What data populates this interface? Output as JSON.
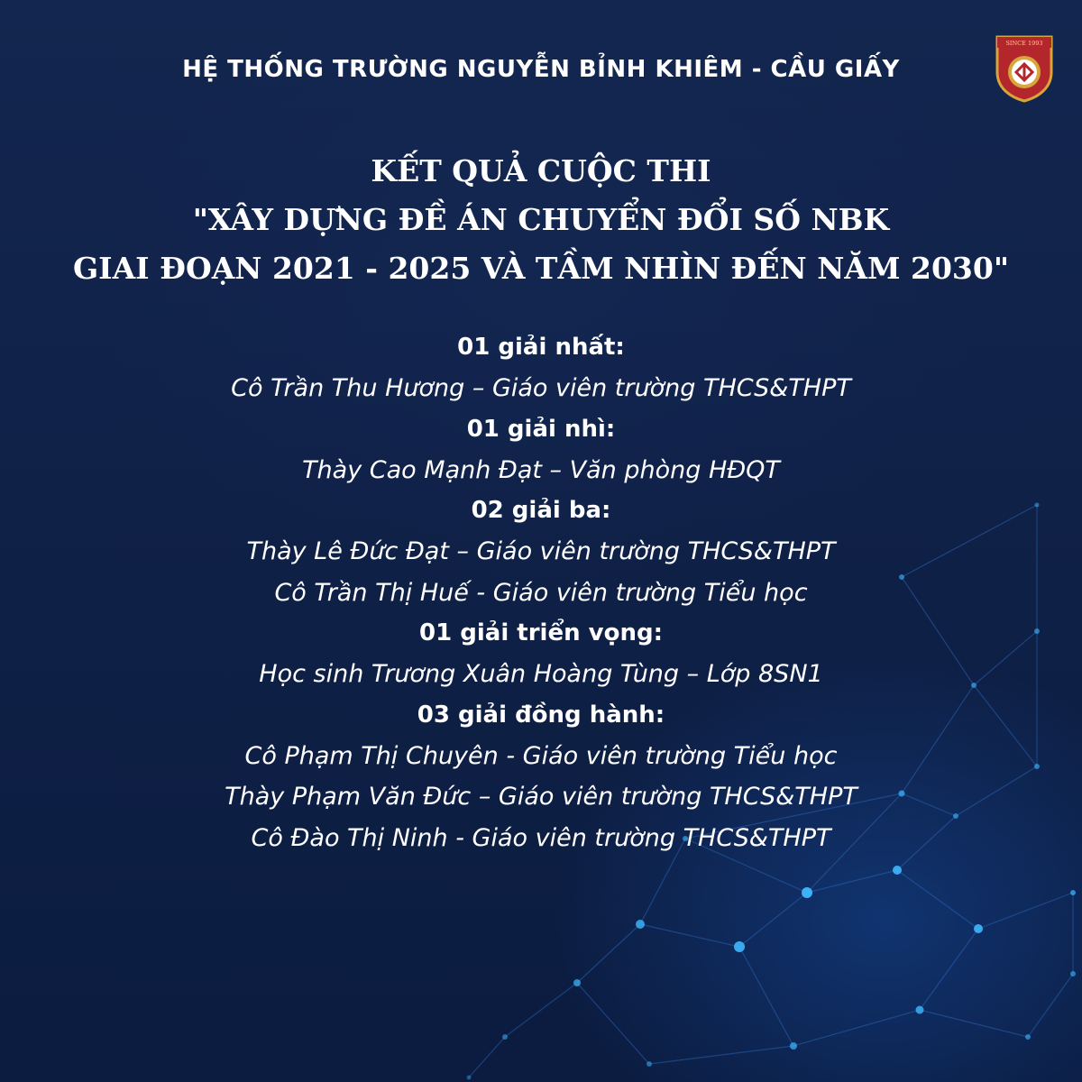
{
  "header": {
    "school_name": "HỆ THỐNG TRƯỜNG NGUYỄN BỈNH KHIÊM - CẦU GIẤY",
    "logo_text": "SINCE 1993"
  },
  "title": {
    "lines": [
      "KẾT QUẢ CUỘC THI",
      "\"XÂY DỰNG ĐỀ ÁN CHUYỂN ĐỔI SỐ NBK",
      "GIAI ĐOẠN 2021 - 2025 VÀ TẦM NHÌN ĐẾN NĂM 2030\""
    ]
  },
  "awards": [
    {
      "label": "01 giải nhất:",
      "winners": [
        "Cô Trần Thu Hương – Giáo viên trường THCS&THPT"
      ]
    },
    {
      "label": "01 giải nhì:",
      "winners": [
        "Thày Cao Mạnh Đạt – Văn phòng HĐQT"
      ]
    },
    {
      "label": "02 giải ba:",
      "winners": [
        "Thày Lê Đức Đạt – Giáo viên trường THCS&THPT",
        "Cô Trần Thị Huế - Giáo viên trường Tiểu học"
      ]
    },
    {
      "label": "01 giải triển vọng:",
      "winners": [
        "Học sinh Trương Xuân Hoàng Tùng – Lớp 8SN1"
      ]
    },
    {
      "label": "03 giải đồng hành:",
      "winners": [
        "Cô Phạm Thị Chuyên - Giáo viên trường Tiểu học",
        "Thày Phạm Văn Đức – Giáo viên trường THCS&THPT",
        "Cô Đào Thị Ninh - Giáo viên trường THCS&THPT"
      ]
    }
  ],
  "colors": {
    "background": "#0f2148",
    "text": "#ffffff",
    "node": "#3fb8ff",
    "logo_red": "#b3262c",
    "logo_gold": "#d8a53a"
  }
}
